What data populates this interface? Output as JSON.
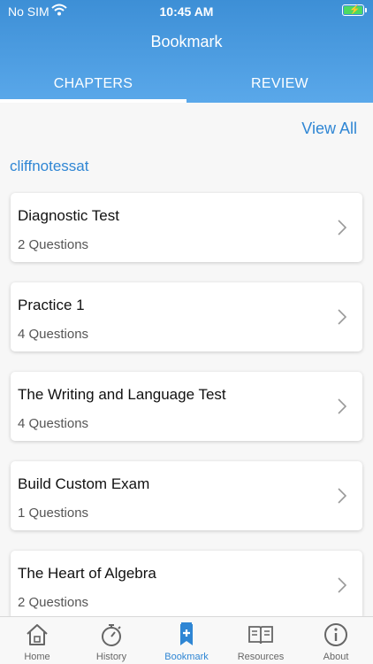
{
  "status": {
    "carrier": "No SIM",
    "time": "10:45 AM"
  },
  "nav": {
    "title": "Bookmark"
  },
  "tabs": [
    {
      "label": "CHAPTERS"
    },
    {
      "label": "REVIEW"
    }
  ],
  "content": {
    "view_all": "View All",
    "group": "cliffnotessat",
    "cards": [
      {
        "title": "Diagnostic Test",
        "sub": "2 Questions"
      },
      {
        "title": "Practice 1",
        "sub": "4 Questions"
      },
      {
        "title": "The Writing and Language Test",
        "sub": "4 Questions"
      },
      {
        "title": "Build Custom Exam",
        "sub": "1 Questions"
      },
      {
        "title": "The Heart of Algebra",
        "sub": "2 Questions"
      }
    ]
  },
  "tabbar": [
    {
      "label": "Home",
      "icon": "home-icon"
    },
    {
      "label": "History",
      "icon": "stopwatch-icon"
    },
    {
      "label": "Bookmark",
      "icon": "bookmark-icon"
    },
    {
      "label": "Resources",
      "icon": "book-icon"
    },
    {
      "label": "About",
      "icon": "info-icon"
    }
  ],
  "colors": {
    "accent": "#2f86d4",
    "header": "#4b9de2",
    "battery": "#4cd964"
  }
}
